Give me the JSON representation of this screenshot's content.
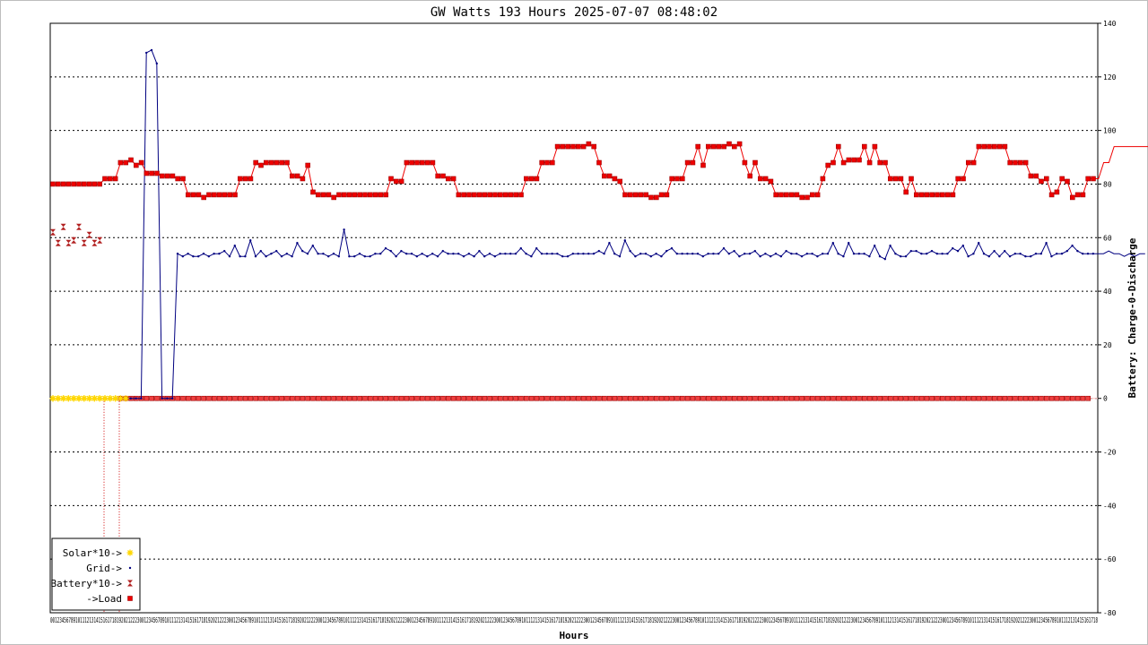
{
  "chart_data": {
    "type": "line",
    "title": "GW Watts 193 Hours 2025-07-07 08:48:02",
    "xlabel": "Hours",
    "ylabel_right": "Battery: Charge-0-Discharge",
    "ylim": [
      -80,
      140
    ],
    "yticks": [
      140,
      120,
      100,
      80,
      60,
      40,
      20,
      0,
      -20,
      -40,
      -60,
      -80
    ],
    "grid": true,
    "legend_placement": "bottom-left",
    "legend": [
      "Solar*10->",
      "Grid->",
      "Battery*10->",
      "->Load"
    ],
    "x_tick_labels": "00123456789101112131415161718192021222300123456789101112131415161718192021222300123456789101112131415161718192021222300123456789101112131415161718192021222300123456789101112131415161718192021222300123456789101112131415161718192021222300123456789101112131415161718192021222300123456789101112131415161718192021222300123456789101112131415161718192021222300123456789101112131415161718192021222300123456789101112131415161718192021222300123456789101112131415161718",
    "series": [
      {
        "name": "Solar*10->",
        "color": "#ffd700",
        "marker": "star",
        "values": [
          0,
          0,
          0,
          0,
          0,
          0,
          0,
          0,
          0,
          0,
          0,
          0,
          0,
          0,
          0
        ]
      },
      {
        "name": "Grid->",
        "color": "#000080",
        "marker": "dot",
        "values": [
          0,
          0,
          0,
          0,
          0,
          0,
          0,
          0,
          0,
          129,
          130,
          125,
          0,
          0,
          0,
          54,
          53,
          54,
          53,
          53,
          54,
          53,
          54,
          54,
          55,
          53,
          57,
          53,
          53,
          59,
          53,
          55,
          53,
          54,
          55,
          53,
          54,
          53,
          58,
          55,
          54,
          57,
          54,
          54,
          53,
          54,
          53,
          63,
          53,
          53,
          54,
          53,
          53,
          54,
          54,
          56,
          55,
          53,
          55,
          54,
          54,
          53,
          54,
          53,
          54,
          53,
          55,
          54,
          54,
          54,
          53,
          54,
          53,
          55,
          53,
          54,
          53,
          54,
          54,
          54,
          54,
          56,
          54,
          53,
          56,
          54,
          54,
          54,
          54,
          53,
          53,
          54,
          54,
          54,
          54,
          54,
          55,
          54,
          58,
          54,
          53,
          59,
          55,
          53,
          54,
          54,
          53,
          54,
          53,
          55,
          56,
          54,
          54,
          54,
          54,
          54,
          53,
          54,
          54,
          54,
          56,
          54,
          55,
          53,
          54,
          54,
          55,
          53,
          54,
          53,
          54,
          53,
          55,
          54,
          54,
          53,
          54,
          54,
          53,
          54,
          54,
          58,
          54,
          53,
          58,
          54,
          54,
          54,
          53,
          57,
          53,
          52,
          57,
          54,
          53,
          53,
          55,
          55,
          54,
          54,
          55,
          54,
          54,
          54,
          56,
          55,
          57,
          53,
          54,
          58,
          54,
          53,
          55,
          53,
          55,
          53,
          54,
          54,
          53,
          53,
          54,
          54,
          58,
          53,
          54,
          54,
          55,
          57,
          55,
          54,
          54,
          54,
          54,
          54,
          55,
          54,
          54,
          53,
          54,
          53,
          54,
          54
        ]
      },
      {
        "name": "Battery*10->",
        "color": "#b22222",
        "marker": "hourglass",
        "values": [
          62,
          58,
          64,
          58,
          59,
          64,
          58,
          61,
          58,
          59,
          0,
          0,
          0,
          0
        ]
      },
      {
        "name": "->Load",
        "color": "#ee0000",
        "marker": "square",
        "values": [
          80,
          80,
          80,
          80,
          80,
          80,
          80,
          80,
          80,
          80,
          82,
          82,
          82,
          88,
          88,
          89,
          87,
          88,
          84,
          84,
          84,
          83,
          83,
          83,
          82,
          82,
          76,
          76,
          76,
          75,
          76,
          76,
          76,
          76,
          76,
          76,
          82,
          82,
          82,
          88,
          87,
          88,
          88,
          88,
          88,
          88,
          83,
          83,
          82,
          87,
          77,
          76,
          76,
          76,
          75,
          76,
          76,
          76,
          76,
          76,
          76,
          76,
          76,
          76,
          76,
          82,
          81,
          81,
          88,
          88,
          88,
          88,
          88,
          88,
          83,
          83,
          82,
          82,
          76,
          76,
          76,
          76,
          76,
          76,
          76,
          76,
          76,
          76,
          76,
          76,
          76,
          82,
          82,
          82,
          88,
          88,
          88,
          94,
          94,
          94,
          94,
          94,
          94,
          95,
          94,
          88,
          83,
          83,
          82,
          81,
          76,
          76,
          76,
          76,
          76,
          75,
          75,
          76,
          76,
          82,
          82,
          82,
          88,
          88,
          94,
          87,
          94,
          94,
          94,
          94,
          95,
          94,
          95,
          88,
          83,
          88,
          82,
          82,
          81,
          76,
          76,
          76,
          76,
          76,
          75,
          75,
          76,
          76,
          82,
          87,
          88,
          94,
          88,
          89,
          89,
          89,
          94,
          88,
          94,
          88,
          88,
          82,
          82,
          82,
          77,
          82,
          76,
          76,
          76,
          76,
          76,
          76,
          76,
          76,
          82,
          82,
          88,
          88,
          94,
          94,
          94,
          94,
          94,
          94,
          88,
          88,
          88,
          88,
          83,
          83,
          81,
          82,
          76,
          77,
          82,
          81,
          75,
          76,
          76,
          82,
          82,
          82,
          88,
          88,
          94,
          94,
          94,
          94,
          94,
          94,
          94,
          94,
          94,
          88,
          88,
          83,
          83,
          83,
          82,
          82,
          82,
          82,
          82,
          81,
          82,
          82
        ]
      }
    ]
  }
}
